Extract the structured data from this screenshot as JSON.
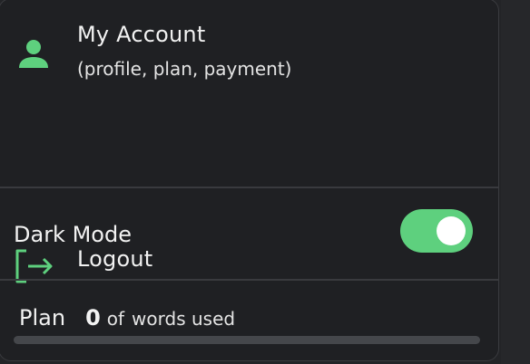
{
  "menu": {
    "account": {
      "title": "My Account",
      "subtitle": "(profile, plan, payment)",
      "icon": "person-icon"
    },
    "logout": {
      "title": "Logout",
      "icon": "logout-icon"
    },
    "dark_mode": {
      "label": "Dark Mode",
      "enabled": true
    },
    "plan": {
      "label": "Plan",
      "used": "0",
      "of_label": "of",
      "words_label": "words used",
      "progress_fraction": 0
    }
  },
  "colors": {
    "accent": "#5ed07e",
    "background": "#1f2023",
    "text": "#f2f2f2",
    "divider": "#393a3e",
    "track": "#45474b"
  }
}
